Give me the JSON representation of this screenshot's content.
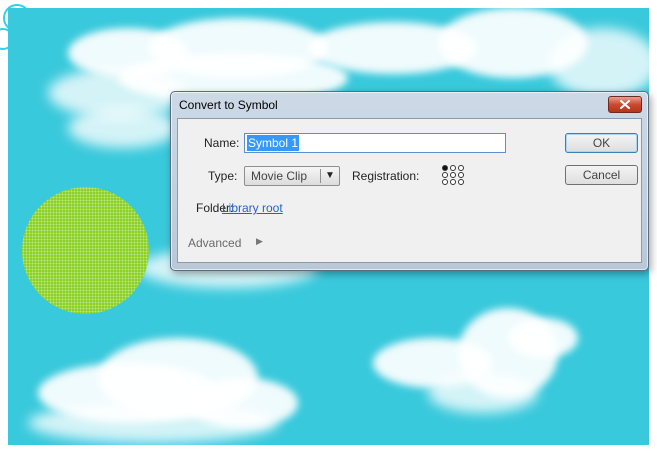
{
  "dialog": {
    "title": "Convert to Symbol",
    "name_label": "Name:",
    "name_value": "Symbol 1",
    "type_label": "Type:",
    "type_value": "Movie Clip",
    "registration_label": "Registration:",
    "folder_label": "Folder:",
    "folder_value": "Library root",
    "advanced_label": "Advanced",
    "ok_label": "OK",
    "cancel_label": "Cancel",
    "close_icon": "close-x-icon",
    "registration_selected": "top-left"
  },
  "colors": {
    "sky": "#39c9dc",
    "circle": "#86cf1e",
    "link": "#1e64c8",
    "close_button": "#c94a32"
  }
}
